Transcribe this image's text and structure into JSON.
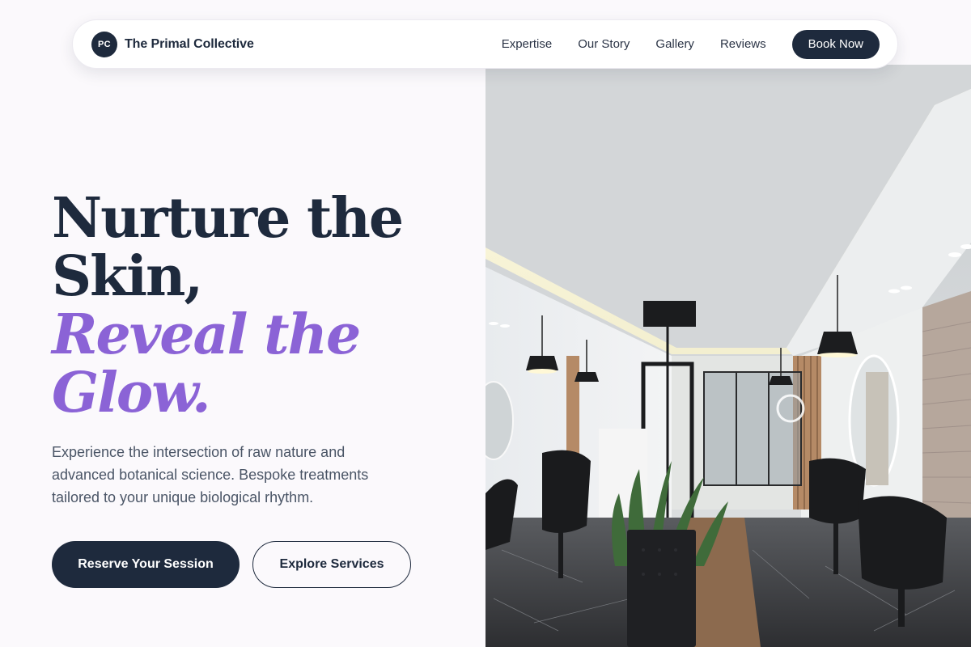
{
  "brand": {
    "initials": "PC",
    "name": "The Primal Collective"
  },
  "nav": {
    "links": [
      "Expertise",
      "Our Story",
      "Gallery",
      "Reviews"
    ],
    "cta": "Book Now"
  },
  "hero": {
    "headline_line1": "Nurture the",
    "headline_line2": "Skin,",
    "headline_accent1": "Reveal the",
    "headline_accent2": "Glow.",
    "description": "Experience the intersection of raw nature and advanced botanical science. Bespoke treatments tailored to your unique biological rhythm.",
    "primary_cta": "Reserve Your Session",
    "secondary_cta": "Explore Services"
  },
  "image": {
    "subject": "salon-interior-photo"
  },
  "colors": {
    "navy": "#1e2a3d",
    "accent_purple": "#8b63d6",
    "background": "#fbf9fc"
  }
}
